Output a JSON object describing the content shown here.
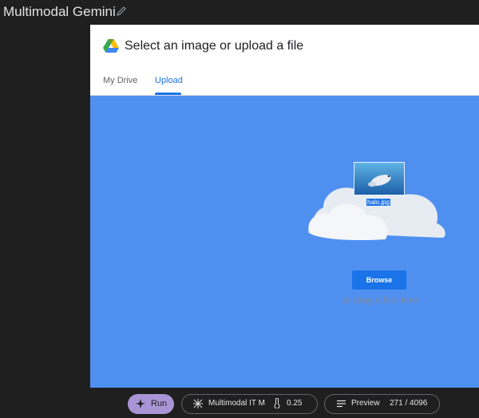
{
  "app": {
    "title": "Multimodal Gemini",
    "edit_icon": "pencil-icon"
  },
  "dialog": {
    "title": "Select an image or upload a file",
    "logo_icon": "google-drive-logo",
    "tabs": [
      {
        "label": "My Drive",
        "active": false
      },
      {
        "label": "Upload",
        "active": true
      }
    ],
    "dragged_file": {
      "name": "halo.jpg"
    },
    "browse_label": "Browse",
    "drag_text": "or drag a file here",
    "colors": {
      "accent": "#1a73e8",
      "drop_zone": "#4f8ff0"
    }
  },
  "bottom": {
    "run_label": "Run",
    "run_icon": "sparkle-icon",
    "model_label": "Multimodal IT M",
    "model_icon": "model-icon",
    "temperature_icon": "thermometer-icon",
    "temperature": "0.25",
    "preview_icon": "menu-lines-icon",
    "preview_label": "Preview",
    "token_count": "271 / 4096",
    "run_color": "#a994d6"
  }
}
